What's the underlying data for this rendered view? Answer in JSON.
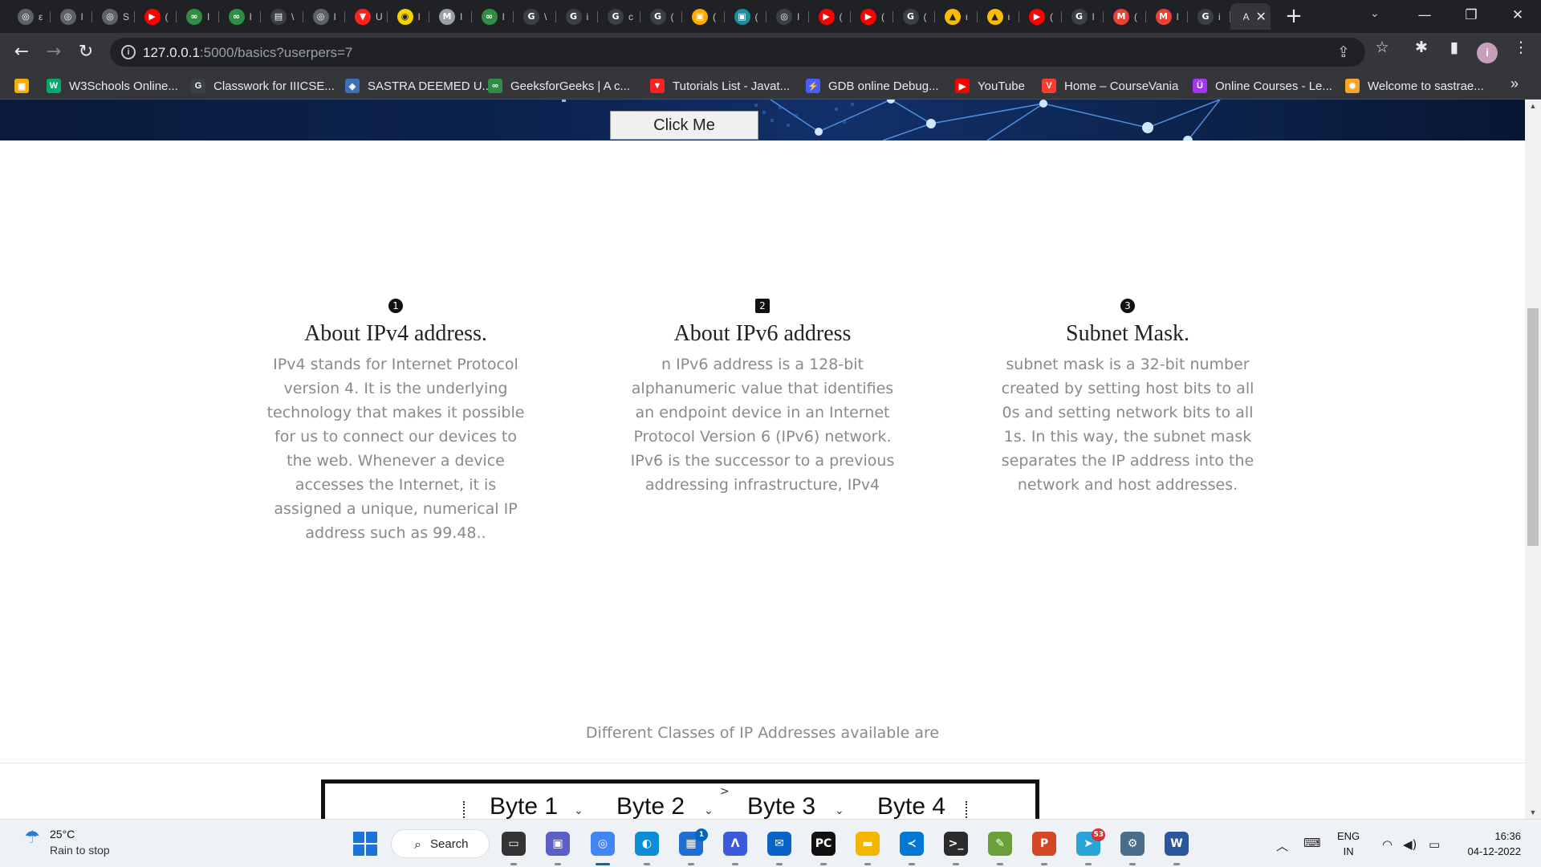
{
  "browser": {
    "tabs": [
      {
        "icon": "globe-icon",
        "color": "#5f6368",
        "glyph": "◎",
        "label": "ε"
      },
      {
        "icon": "globe-icon",
        "color": "#5f6368",
        "glyph": "◎",
        "label": "I"
      },
      {
        "icon": "globe-icon",
        "color": "#5f6368",
        "glyph": "◎",
        "label": "S"
      },
      {
        "icon": "youtube-icon",
        "color": "#ff0000",
        "glyph": "▶",
        "label": "("
      },
      {
        "icon": "geeksforgeeks-icon",
        "color": "#2f8d46",
        "glyph": "∞",
        "label": "I"
      },
      {
        "icon": "geeksforgeeks-icon",
        "color": "#2f8d46",
        "glyph": "∞",
        "label": "I"
      },
      {
        "icon": "document-icon",
        "color": "#ffffff",
        "glyph": "▤",
        "label": "\\"
      },
      {
        "icon": "globe-icon",
        "color": "#5f6368",
        "glyph": "◎",
        "label": "I"
      },
      {
        "icon": "tutorialspoint-icon",
        "color": "#ff2020",
        "glyph": "▼",
        "label": "U"
      },
      {
        "icon": "codechef-icon",
        "color": "#f5d300",
        "glyph": "◉",
        "label": "I"
      },
      {
        "icon": "medium-icon",
        "color": "#9aa0a6",
        "glyph": "M",
        "label": "I"
      },
      {
        "icon": "geeksforgeeks-icon",
        "color": "#2f8d46",
        "glyph": "∞",
        "label": "I"
      },
      {
        "icon": "google-icon",
        "color": "#ffffff",
        "glyph": "G",
        "label": "\\"
      },
      {
        "icon": "google-icon",
        "color": "#ffffff",
        "glyph": "G",
        "label": "i"
      },
      {
        "icon": "google-icon",
        "color": "#ffffff",
        "glyph": "G",
        "label": "c"
      },
      {
        "icon": "google-icon",
        "color": "#ffffff",
        "glyph": "G",
        "label": "("
      },
      {
        "icon": "classroom-icon",
        "color": "#f9ab00",
        "glyph": "▣",
        "label": "("
      },
      {
        "icon": "classroom-icon",
        "color": "#1e8e9e",
        "glyph": "▣",
        "label": "("
      },
      {
        "icon": "chrome-icon",
        "color": "#ffffff",
        "glyph": "◎",
        "label": "I"
      },
      {
        "icon": "youtube-icon",
        "color": "#ff0000",
        "glyph": "▶",
        "label": "("
      },
      {
        "icon": "youtube-icon",
        "color": "#ff0000",
        "glyph": "▶",
        "label": "("
      },
      {
        "icon": "google-icon",
        "color": "#ffffff",
        "glyph": "G",
        "label": "("
      },
      {
        "icon": "drive-icon",
        "color": "#fbbc04",
        "glyph": "▲",
        "label": "ι"
      },
      {
        "icon": "drive-icon",
        "color": "#fbbc04",
        "glyph": "▲",
        "label": "ι"
      },
      {
        "icon": "youtube-icon",
        "color": "#ff0000",
        "glyph": "▶",
        "label": "("
      },
      {
        "icon": "google-icon",
        "color": "#ffffff",
        "glyph": "G",
        "label": "I"
      },
      {
        "icon": "gmail-icon",
        "color": "#ea4335",
        "glyph": "M",
        "label": "("
      },
      {
        "icon": "gmail-icon",
        "color": "#ea4335",
        "glyph": "M",
        "label": "I"
      },
      {
        "icon": "google-icon",
        "color": "#ffffff",
        "glyph": "G",
        "label": "i"
      }
    ],
    "active_tab": {
      "label": "A",
      "close": "✕"
    },
    "new_tab": "+",
    "tab_search": "⌄",
    "window_controls": {
      "minimize": "—",
      "restore": "❐",
      "close": "✕"
    },
    "nav": {
      "back": "←",
      "forward": "→",
      "reload": "↻"
    },
    "url": {
      "host": "127.0.0.1",
      "path": ":5000/basics?userpers=7"
    },
    "toolbar_icons": {
      "share": "⇪",
      "star": "☆",
      "extensions": "✱",
      "sidepanel": "▮",
      "menu": "⋮"
    },
    "profile_initial": "i",
    "bookmarks": [
      {
        "icon": "classroom-icon",
        "color": "#f9ab00",
        "glyph": "▣",
        "label": ""
      },
      {
        "icon": "w3schools-icon",
        "color": "#04aa6d",
        "glyph": "W",
        "label": "W3Schools Online..."
      },
      {
        "icon": "google-icon",
        "color": "#ffffff",
        "glyph": "G",
        "label": "Classwork for IIICSE..."
      },
      {
        "icon": "sastra-icon",
        "color": "#3c6fb6",
        "glyph": "◈",
        "label": "SASTRA DEEMED U..."
      },
      {
        "icon": "geeksforgeeks-icon",
        "color": "#2f8d46",
        "glyph": "∞",
        "label": "GeeksforGeeks | A c..."
      },
      {
        "icon": "tutorialspoint-icon",
        "color": "#ff2020",
        "glyph": "▼",
        "label": "Tutorials List - Javat..."
      },
      {
        "icon": "gdb-icon",
        "color": "#4a5cff",
        "glyph": "⚡",
        "label": "GDB online Debug..."
      },
      {
        "icon": "youtube-icon",
        "color": "#ff0000",
        "glyph": "▶",
        "label": "YouTube"
      },
      {
        "icon": "coursevania-icon",
        "color": "#ff3b30",
        "glyph": "V",
        "label": "Home – CourseVania"
      },
      {
        "icon": "udemy-icon",
        "color": "#a435f0",
        "glyph": "Ü",
        "label": "Online Courses - Le..."
      },
      {
        "icon": "sastra-sun-icon",
        "color": "#f5a623",
        "glyph": "✹",
        "label": "Welcome to sastrae..."
      }
    ],
    "bookmarks_more": "»"
  },
  "page": {
    "hero_button": "Click Me",
    "features": [
      {
        "number": "1",
        "badge": "circle",
        "title": "About IPv4 address.",
        "text": "IPv4 stands for Internet Protocol version 4. It is the underlying technology that makes it possible for us to connect our devices to the web. Whenever a device accesses the Internet, it is assigned a unique, numerical IP address such as 99.48.."
      },
      {
        "number": "2",
        "badge": "square",
        "title": "About IPv6 address",
        "text": "n IPv6 address is a 128-bit alphanumeric value that identifies an endpoint device in an Internet Protocol Version 6 (IPv6) network. IPv6 is the successor to a previous addressing infrastructure, IPv4"
      },
      {
        "number": "3",
        "badge": "circle",
        "title": "Subnet Mask.",
        "text": "subnet mask is a 32-bit number created by setting host bits to all 0s and setting network bits to all 1s. In this way, the subnet mask separates the IP address into the network and host addresses."
      }
    ],
    "classes_heading": "Different Classes of IP Addresses available are",
    "diagram": {
      "bytes": [
        "Byte 1",
        "Byte 2",
        "Byte 3",
        "Byte 4"
      ],
      "arrow": ">",
      "chevron": "⌄"
    }
  },
  "scrollbar": {
    "up": "▲",
    "down": "▼",
    "position": 0.43
  },
  "taskbar": {
    "weather": {
      "icon": "umbrella-icon",
      "glyph": "☂",
      "temp": "25°C",
      "desc": "Rain to stop"
    },
    "search_label": "Search",
    "search_glyph": "⌕",
    "apps": [
      {
        "name": "file-explorer-window-icon",
        "glyph": "▭",
        "color": "#333333",
        "badge": ""
      },
      {
        "name": "teams-icon",
        "glyph": "▣",
        "color": "#5b5fc7",
        "badge": ""
      },
      {
        "name": "chrome-icon",
        "glyph": "◎",
        "color": "#4285f4",
        "badge": ""
      },
      {
        "name": "edge-icon",
        "glyph": "◐",
        "color": "#0c8dd6",
        "badge": ""
      },
      {
        "name": "store-icon",
        "glyph": "▦",
        "color": "#1f6fd1",
        "badge": "1"
      },
      {
        "name": "azure-icon",
        "glyph": "Λ",
        "color": "#3b5bdb",
        "badge": ""
      },
      {
        "name": "mail-icon",
        "glyph": "✉",
        "color": "#0a64c8",
        "badge": ""
      },
      {
        "name": "pycharm-icon",
        "glyph": "PC",
        "color": "#111111",
        "badge": ""
      },
      {
        "name": "folder-icon",
        "glyph": "▬",
        "color": "#f4b400",
        "badge": ""
      },
      {
        "name": "vscode-icon",
        "glyph": "≺",
        "color": "#0078d4",
        "badge": ""
      },
      {
        "name": "terminal-icon",
        "glyph": ">_",
        "color": "#2b2b2b",
        "badge": ""
      },
      {
        "name": "photos-icon",
        "glyph": "✎",
        "color": "#6a9f3a",
        "badge": ""
      },
      {
        "name": "powerpoint-icon",
        "glyph": "P",
        "color": "#d24726",
        "badge": ""
      },
      {
        "name": "telegram-icon",
        "glyph": "➤",
        "color": "#2aa3d9",
        "badge": "53"
      },
      {
        "name": "settings-icon",
        "glyph": "⚙",
        "color": "#4a6d8c",
        "badge": ""
      },
      {
        "name": "word-icon",
        "glyph": "W",
        "color": "#2b579a",
        "badge": ""
      }
    ],
    "tray": {
      "chevron": "︿",
      "keyboard": "⌨",
      "wifi": "◠",
      "volume": "◀)",
      "battery": "▭"
    },
    "lang_line1": "ENG",
    "lang_line2": "IN",
    "time": "16:36",
    "date": "04-12-2022"
  }
}
